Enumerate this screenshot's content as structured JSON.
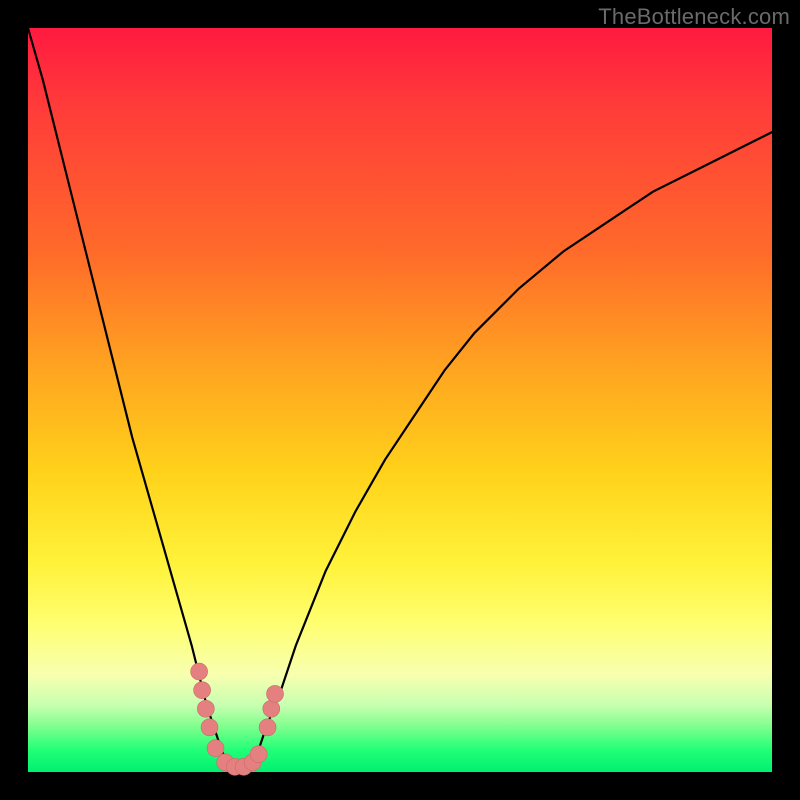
{
  "watermark": "TheBottleneck.com",
  "colors": {
    "frame": "#000000",
    "curve": "#000000",
    "marker_fill": "#e58080",
    "marker_stroke": "#c86b6b",
    "gradient_top": "#ff1a40",
    "gradient_bottom": "#00f070"
  },
  "chart_data": {
    "type": "line",
    "title": "",
    "xlabel": "",
    "ylabel": "",
    "xlim": [
      0,
      100
    ],
    "ylim": [
      0,
      100
    ],
    "grid": false,
    "legend": false,
    "description": "V-shaped bottleneck curve. y is percentage from bottom (0 = baseline / no bottleneck, 100 = severe). Minimum near x≈27.",
    "x": [
      0,
      2,
      4,
      6,
      8,
      10,
      12,
      14,
      16,
      18,
      20,
      22,
      24,
      25,
      26,
      27,
      28,
      29,
      30,
      31,
      32,
      34,
      36,
      38,
      40,
      44,
      48,
      52,
      56,
      60,
      66,
      72,
      78,
      84,
      90,
      96,
      100
    ],
    "y": [
      100,
      93,
      85,
      77,
      69,
      61,
      53,
      45,
      38,
      31,
      24,
      17,
      9,
      6,
      3,
      0.5,
      0.5,
      0.5,
      1,
      3,
      6,
      11,
      17,
      22,
      27,
      35,
      42,
      48,
      54,
      59,
      65,
      70,
      74,
      78,
      81,
      84,
      86
    ],
    "markers": {
      "description": "cluster of highlighted points near the trough",
      "points": [
        {
          "x": 23.0,
          "y": 13.5
        },
        {
          "x": 23.4,
          "y": 11.0
        },
        {
          "x": 23.9,
          "y": 8.5
        },
        {
          "x": 24.4,
          "y": 6.0
        },
        {
          "x": 25.2,
          "y": 3.2
        },
        {
          "x": 26.5,
          "y": 1.3
        },
        {
          "x": 27.8,
          "y": 0.7
        },
        {
          "x": 29.0,
          "y": 0.7
        },
        {
          "x": 30.2,
          "y": 1.3
        },
        {
          "x": 31.0,
          "y": 2.4
        },
        {
          "x": 32.2,
          "y": 6.0
        },
        {
          "x": 32.7,
          "y": 8.5
        },
        {
          "x": 33.2,
          "y": 10.5
        }
      ]
    }
  }
}
